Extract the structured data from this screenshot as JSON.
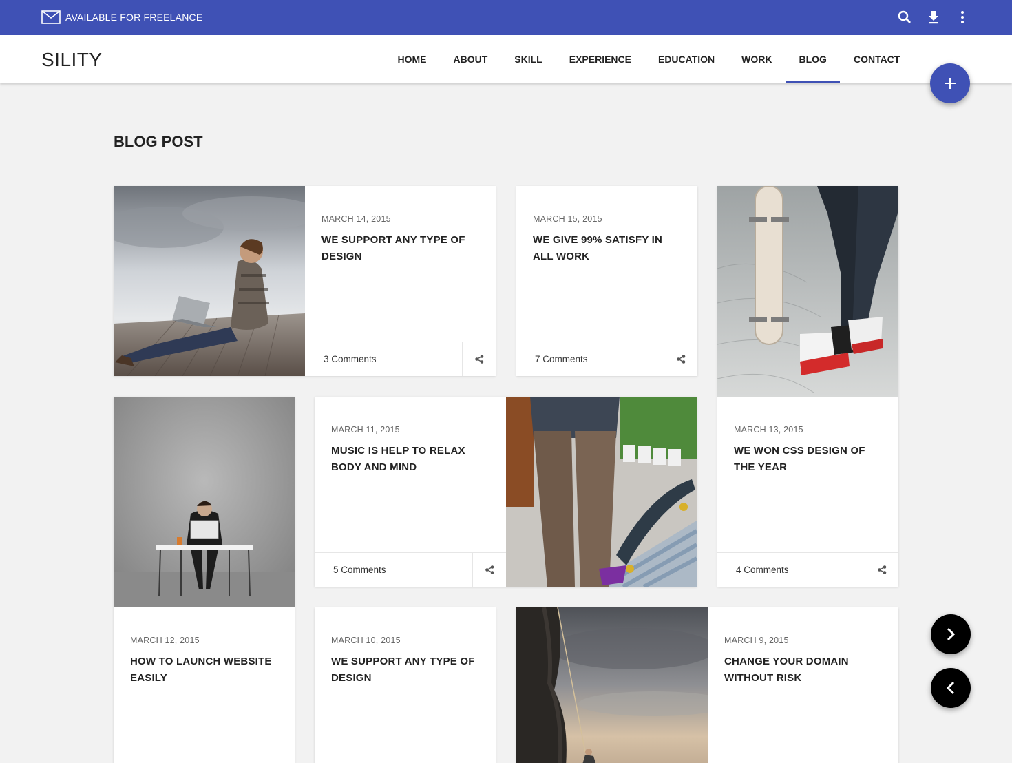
{
  "topbar": {
    "freelance_text": "AVAILABLE FOR FREELANCE",
    "icons": [
      "mail-icon",
      "search-icon",
      "download-icon",
      "more-vert-icon"
    ],
    "color": "#3f51b5"
  },
  "navbar": {
    "logo": "SILITY",
    "items": [
      {
        "label": "HOME"
      },
      {
        "label": "ABOUT"
      },
      {
        "label": "SKILL"
      },
      {
        "label": "EXPERIENCE"
      },
      {
        "label": "EDUCATION"
      },
      {
        "label": "WORK"
      },
      {
        "label": "BLOG",
        "active": true
      },
      {
        "label": "CONTACT"
      }
    ]
  },
  "fabs": {
    "add_icon": "plus-icon",
    "next_icon": "chevron-right-icon",
    "prev_icon": "chevron-left-icon"
  },
  "main": {
    "section_title": "BLOG POST",
    "posts": [
      {
        "date": "MARCH 14, 2015",
        "title": "WE SUPPORT ANY TYPE OF DESIGN",
        "comments": "3 Comments",
        "image": "man-with-laptop-on-pier"
      },
      {
        "date": "MARCH 15, 2015",
        "title": "WE GIVE 99% SATISFY IN ALL WORK",
        "comments": "7 Comments"
      },
      {
        "date": "MARCH 13, 2015",
        "title": "WE WON CSS DESIGN OF THE YEAR",
        "comments": "4 Comments",
        "image": "skateboarder-legs"
      },
      {
        "date": "MARCH 12, 2015",
        "title": "HOW TO LAUNCH WEBSITE EASILY",
        "image": "man-at-desk-concrete-wall"
      },
      {
        "date": "MARCH 11, 2015",
        "title": "MUSIC IS HELP TO RELAX BODY AND MIND",
        "comments": "5 Comments",
        "image": "skater-on-stairs"
      },
      {
        "date": "MARCH 10, 2015",
        "title": "WE SUPPORT ANY TYPE OF DESIGN"
      },
      {
        "date": "MARCH 9, 2015",
        "title": "CHANGE YOUR DOMAIN WITHOUT RISK",
        "image": "rock-climber-at-sunset"
      }
    ]
  }
}
